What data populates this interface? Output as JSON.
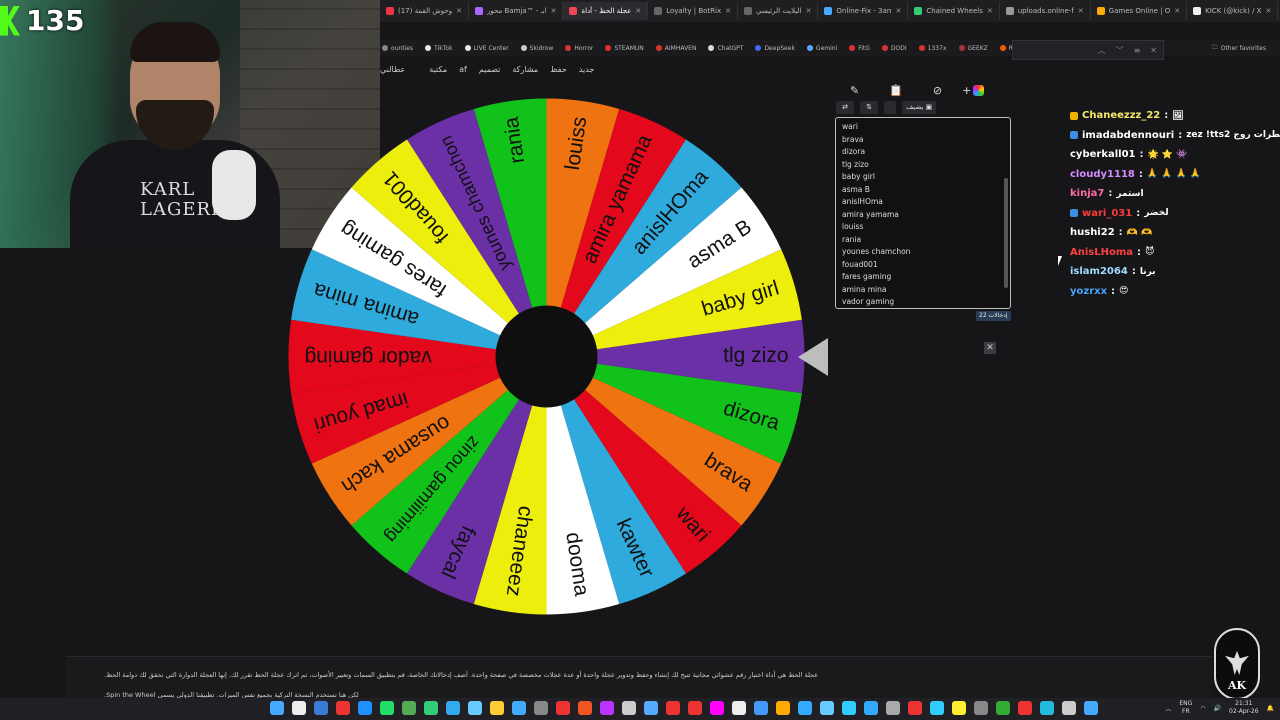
{
  "webcam": {
    "viewer_count": "135",
    "shirt_line1": "KARL",
    "shirt_line2": "LAGERFE"
  },
  "browser": {
    "tabs": [
      {
        "label": "(17) وحوش القمة",
        "color": "#e34"
      },
      {
        "label": "محور Bamja™ - ابـ",
        "color": "#a6f"
      },
      {
        "label": "عجلة الحظ - أداة",
        "color": "#e45",
        "active": true
      },
      {
        "label": "Loyalty | BotRix",
        "color": "#666"
      },
      {
        "label": "اليلايت الرئيسي",
        "color": "#666"
      },
      {
        "label": "Online-Fix - Зап",
        "color": "#4af"
      },
      {
        "label": "Chained Wheels",
        "color": "#3c7"
      },
      {
        "label": "uploads.online-f",
        "color": "#999"
      },
      {
        "label": "Games Online | O",
        "color": "#fa0"
      },
      {
        "label": "KICK (@kick) / X",
        "color": "#eee"
      },
      {
        "label": "Remove Duplica",
        "color": "#4af"
      }
    ],
    "bookmarks": [
      {
        "label": "ounties",
        "color": "#888"
      },
      {
        "label": "TikTok",
        "color": "#eee"
      },
      {
        "label": "LIVE Center",
        "color": "#eee"
      },
      {
        "label": "Skidrow",
        "color": "#ccc"
      },
      {
        "label": "Horror",
        "color": "#d33"
      },
      {
        "label": "STEAMUN",
        "color": "#d33"
      },
      {
        "label": "AIMHAVEN",
        "color": "#d33"
      },
      {
        "label": "ChatGPT",
        "color": "#ddd"
      },
      {
        "label": "DeepSeek",
        "color": "#46f"
      },
      {
        "label": "Gemini",
        "color": "#5af"
      },
      {
        "label": "FitG",
        "color": "#d33"
      },
      {
        "label": "DODI",
        "color": "#d33"
      },
      {
        "label": "1337x",
        "color": "#d33"
      },
      {
        "label": "GEEKZ",
        "color": "#a33"
      },
      {
        "label": "Reddit",
        "color": "#f50"
      }
    ],
    "other_favorites": "Other favorites",
    "app_actions": [
      "جديد",
      "حفظ",
      "مشاركة",
      "تصميم",
      "af",
      "مكتبة",
      "",
      "عطالني"
    ]
  },
  "wheel": {
    "segments": [
      {
        "label": "tlg zizo",
        "color": "#6b2fa6"
      },
      {
        "label": "dizora",
        "color": "#11c21a"
      },
      {
        "label": "brava",
        "color": "#f07311"
      },
      {
        "label": "wari",
        "color": "#e3081b"
      },
      {
        "label": "kawter",
        "color": "#2eaadc"
      },
      {
        "label": "dooma",
        "color": "#ffffff"
      },
      {
        "label": "chaneeez",
        "color": "#eeee0c"
      },
      {
        "label": "faycal",
        "color": "#6b2fa6"
      },
      {
        "label": "zinou gamiiiming",
        "color": "#11c21a"
      },
      {
        "label": "ousama kach",
        "color": "#f07311"
      },
      {
        "label": "imad youri",
        "color": "#e3081b"
      },
      {
        "label": "vador gaming",
        "color": "#e3081b"
      },
      {
        "label": "amina mina",
        "color": "#2eaadc"
      },
      {
        "label": "fares gaming",
        "color": "#ffffff"
      },
      {
        "label": "fouad001",
        "color": "#eeee0c"
      },
      {
        "label": "younes chamchon",
        "color": "#6b2fa6"
      },
      {
        "label": "rania",
        "color": "#11c21a"
      },
      {
        "label": "louiss",
        "color": "#f07311"
      },
      {
        "label": "amira yamama",
        "color": "#e3081b"
      },
      {
        "label": "anislHOma",
        "color": "#2eaadc"
      },
      {
        "label": "asma B",
        "color": "#ffffff"
      },
      {
        "label": "baby girl",
        "color": "#eeee0c"
      }
    ]
  },
  "entries_panel": {
    "controls": {
      "shuffle": "⇄",
      "sort": "⇅",
      "add_image": "يضيف"
    },
    "entries": [
      "wari",
      "brava",
      "dizora",
      "tlg zizo",
      "baby girl",
      "asma B",
      "anislHOma",
      "amira yamama",
      "louiss",
      "rania",
      "younes chamchon",
      "fouad001",
      "fares gaming",
      "amina mina",
      "vador gaming"
    ],
    "count_label": "إدخالات 22"
  },
  "chat": [
    {
      "user": "Chaneezzz_22",
      "color": "#f5e96b",
      "badge": "#f0b400",
      "msg": "🖼"
    },
    {
      "user": "imadabdennouri",
      "color": "#ffffff",
      "badge": "#3a8ee6",
      "msg": "zez !tts2 خطرات روج"
    },
    {
      "user": "cyberkall01",
      "color": "#ffffff",
      "badge": "",
      "msg": "🌟 ⭐ 👾"
    },
    {
      "user": "cloudy1118",
      "color": "#d58cff",
      "badge": "",
      "msg": "🙏 🙏 🙏 🙏"
    },
    {
      "user": "kinja7",
      "color": "#ff6aa8",
      "badge": "",
      "msg": "استمر"
    },
    {
      "user": "wari_031",
      "color": "#ff3b3b",
      "badge": "#3a8ee6",
      "msg": "لخضر"
    },
    {
      "user": "hushi22",
      "color": "#ffffff",
      "badge": "",
      "msg": "🫶 🫶"
    },
    {
      "user": "AnisLHoma",
      "color": "#ff4040",
      "badge": "",
      "msg": "😈"
    },
    {
      "user": "islam2064",
      "color": "#9fdcff",
      "badge": "",
      "msg": "برنا"
    },
    {
      "user": "yozrxx",
      "color": "#4aa3ff",
      "badge": "",
      "msg": "😍"
    }
  ],
  "description": {
    "line1": "عجلة الحظ هي أداة اختيار رقم عشوائي مجانية تتيح لك إنشاء وحفظ وتدوير عجلة واحدة أو عدة عجلات مخصصة في صفحة واحدة. أضف إدخالاتك الخاصة، قم بتطبيق السمات وتغيير الأصوات، ثم اترك عجلة الحظ تقرر لك. إنها العجلة الدوارة التي تحقق لك دوامة الحظ.",
    "line2": "لكن هنا تستخدم النسخة التركية بجميع نفس الميزات. تطبيقنا الدولي يسمى Spin the Wheel."
  },
  "logo_badge": {
    "text": "AK"
  },
  "taskbar": {
    "icon_colors": [
      "#4af",
      "#eee",
      "#3a7bd5",
      "#e33",
      "#1e90ff",
      "#2d6",
      "#5a5",
      "#3c7",
      "#3ae",
      "#6cf",
      "#fc3",
      "#4af",
      "#888",
      "#e33",
      "#e52",
      "#b3f",
      "#ccc",
      "#5af",
      "#e33",
      "#e33",
      "#f0f",
      "#eee",
      "#49f",
      "#fa0",
      "#3af",
      "#6cf",
      "#3cf",
      "#3af",
      "#aaa",
      "#e33",
      "#3cf",
      "#fe3",
      "#888",
      "#3a3",
      "#e33",
      "#2bd",
      "#ccc",
      "#4af"
    ],
    "lang_line1": "ENG",
    "lang_line2": "FR",
    "time": "21:31",
    "date": "02-Apr-26"
  }
}
